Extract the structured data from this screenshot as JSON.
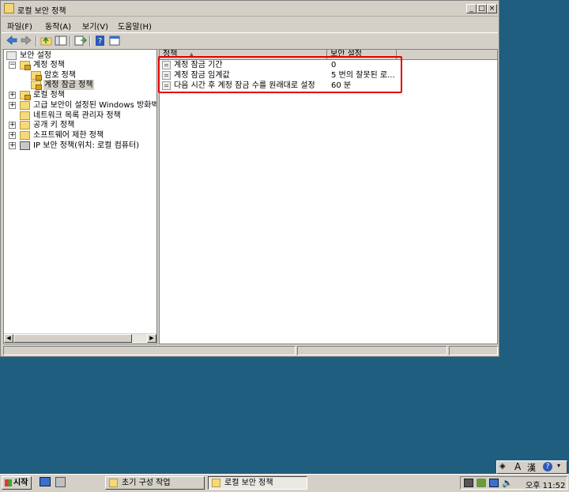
{
  "window": {
    "title": "로컬 보안 정책"
  },
  "menu": {
    "file": "파일(F)",
    "action": "동작(A)",
    "view": "보기(V)",
    "help": "도움말(H)"
  },
  "tree": {
    "root": "보안 설정",
    "account_policy": "계정 정책",
    "password_policy": "암호 정책",
    "lockout_policy": "계정 잠금 정책",
    "local_policy": "로컬 정책",
    "firewall": "고급 보안이 설정된 Windows 방화벽",
    "network_list": "네트워크 목록 관리자 정책",
    "public_key": "공개 키 정책",
    "software_restriction": "소프트웨어 제한 정책",
    "ip_security": "IP 보안 정책(위치: 로컬 컴퓨터)"
  },
  "list": {
    "col_policy": "정책",
    "col_setting": "보안 설정",
    "rows": [
      {
        "policy": "계정 잠금 기간",
        "setting": "0"
      },
      {
        "policy": "계정 잠금 임계값",
        "setting": "5 번의 잘못된 로..."
      },
      {
        "policy": "다음 시간 후 계정 잠금 수를 원래대로 설정",
        "setting": "60 분"
      }
    ]
  },
  "taskbar": {
    "start": "시작",
    "tasks": [
      "초기 구성 작업",
      "로컬 보안 정책"
    ],
    "clock": "오후 11:52"
  },
  "colors": {
    "highlight": "#e00000",
    "desktop": "#1f5e7f"
  }
}
